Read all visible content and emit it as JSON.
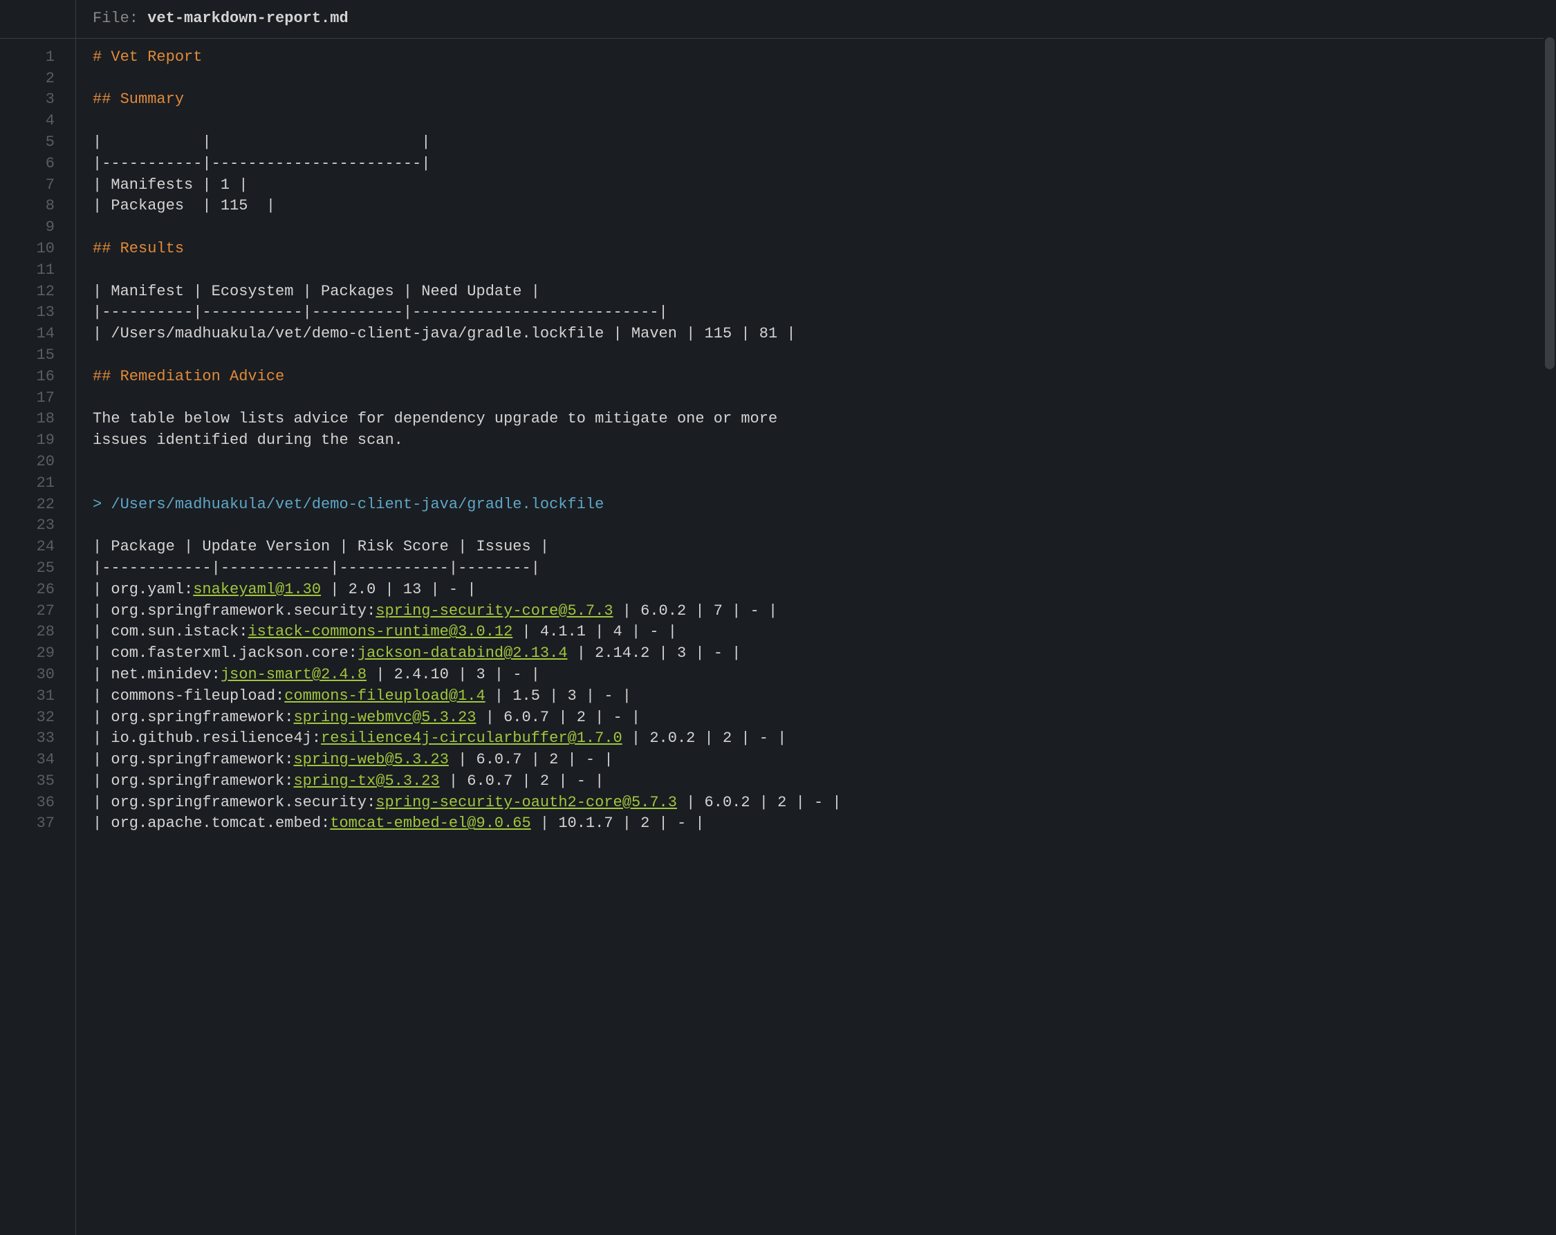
{
  "header": {
    "file_label": "File: ",
    "filename": "vet-markdown-report.md"
  },
  "gutter": {
    "start": 1,
    "end": 37
  },
  "lines": [
    {
      "type": "heading",
      "text": "# Vet Report"
    },
    {
      "type": "blank",
      "text": ""
    },
    {
      "type": "heading",
      "text": "## Summary"
    },
    {
      "type": "blank",
      "text": ""
    },
    {
      "type": "plain",
      "text": "|           |                       |"
    },
    {
      "type": "plain",
      "text": "|-----------|-----------------------|"
    },
    {
      "type": "plain",
      "text": "| Manifests | 1 |"
    },
    {
      "type": "plain",
      "text": "| Packages  | 115  |"
    },
    {
      "type": "blank",
      "text": ""
    },
    {
      "type": "heading",
      "text": "## Results"
    },
    {
      "type": "blank",
      "text": ""
    },
    {
      "type": "plain",
      "text": "| Manifest | Ecosystem | Packages | Need Update |"
    },
    {
      "type": "plain",
      "text": "|----------|-----------|----------|---------------------------|"
    },
    {
      "type": "plain",
      "text": "| /Users/madhuakula/vet/demo-client-java/gradle.lockfile | Maven | 115 | 81 |"
    },
    {
      "type": "blank",
      "text": ""
    },
    {
      "type": "heading",
      "text": "## Remediation Advice"
    },
    {
      "type": "blank",
      "text": ""
    },
    {
      "type": "plain",
      "text": "The table below lists advice for dependency upgrade to mitigate one or more"
    },
    {
      "type": "plain",
      "text": "issues identified during the scan."
    },
    {
      "type": "blank",
      "text": ""
    },
    {
      "type": "blank",
      "text": ""
    },
    {
      "type": "quote",
      "text": "> /Users/madhuakula/vet/demo-client-java/gradle.lockfile"
    },
    {
      "type": "blank",
      "text": ""
    },
    {
      "type": "plain",
      "text": "| Package | Update Version | Risk Score | Issues |"
    },
    {
      "type": "plain",
      "text": "|------------|------------|------------|--------|"
    },
    {
      "type": "pkg",
      "prefix": "| org.yaml:",
      "link": "snakeyaml@1.30",
      "suffix": " | 2.0 | 13 | - |"
    },
    {
      "type": "pkg",
      "prefix": "| org.springframework.security:",
      "link": "spring-security-core@5.7.3",
      "suffix": " | 6.0.2 | 7 | - |"
    },
    {
      "type": "pkg",
      "prefix": "| com.sun.istack:",
      "link": "istack-commons-runtime@3.0.12",
      "suffix": " | 4.1.1 | 4 | - |"
    },
    {
      "type": "pkg",
      "prefix": "| com.fasterxml.jackson.core:",
      "link": "jackson-databind@2.13.4",
      "suffix": " | 2.14.2 | 3 | - |"
    },
    {
      "type": "pkg",
      "prefix": "| net.minidev:",
      "link": "json-smart@2.4.8",
      "suffix": " | 2.4.10 | 3 | - |"
    },
    {
      "type": "pkg",
      "prefix": "| commons-fileupload:",
      "link": "commons-fileupload@1.4",
      "suffix": " | 1.5 | 3 | - |"
    },
    {
      "type": "pkg",
      "prefix": "| org.springframework:",
      "link": "spring-webmvc@5.3.23",
      "suffix": " | 6.0.7 | 2 | - |"
    },
    {
      "type": "pkg",
      "prefix": "| io.github.resilience4j:",
      "link": "resilience4j-circularbuffer@1.7.0",
      "suffix": " | 2.0.2 | 2 | - |"
    },
    {
      "type": "pkg",
      "prefix": "| org.springframework:",
      "link": "spring-web@5.3.23",
      "suffix": " | 6.0.7 | 2 | - |"
    },
    {
      "type": "pkg",
      "prefix": "| org.springframework:",
      "link": "spring-tx@5.3.23",
      "suffix": " | 6.0.7 | 2 | - |"
    },
    {
      "type": "pkg",
      "prefix": "| org.springframework.security:",
      "link": "spring-security-oauth2-core@5.7.3",
      "suffix": " | 6.0.2 | 2 | - |"
    },
    {
      "type": "pkg",
      "prefix": "| org.apache.tomcat.embed:",
      "link": "tomcat-embed-el@9.0.65",
      "suffix": " | 10.1.7 | 2 | - |"
    }
  ]
}
